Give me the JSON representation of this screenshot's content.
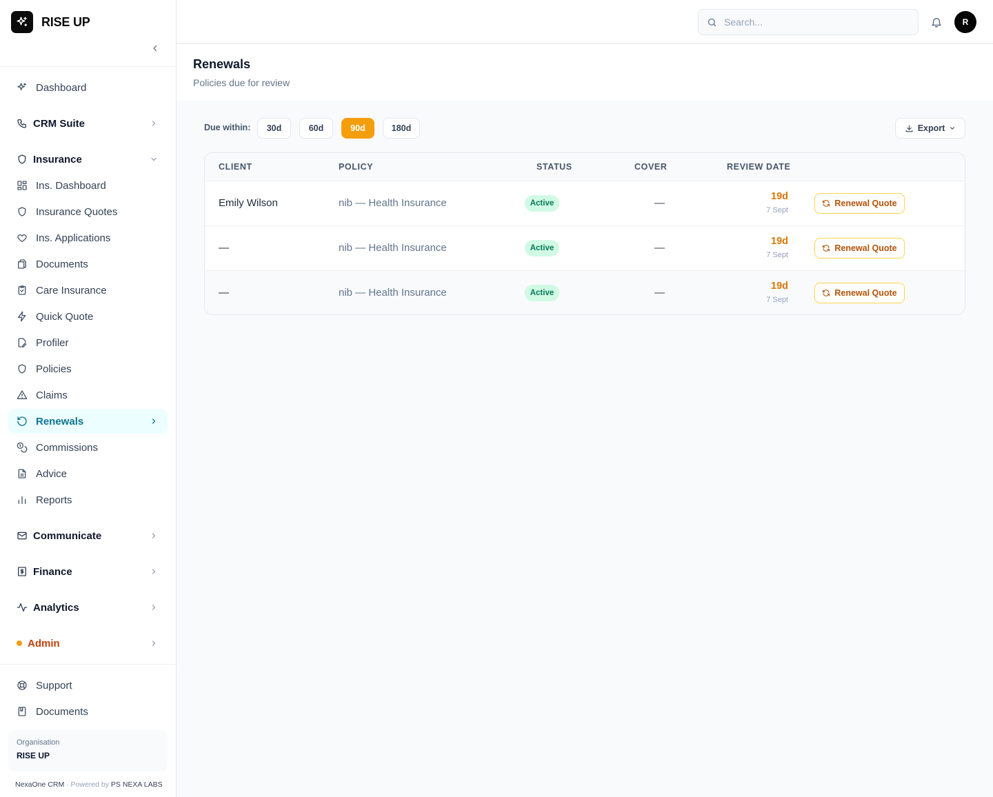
{
  "brand": {
    "name": "RISE UP"
  },
  "sidebar": {
    "items": [
      {
        "label": "Dashboard"
      },
      {
        "label": "CRM Suite"
      },
      {
        "label": "Insurance"
      },
      {
        "label": "Ins. Dashboard"
      },
      {
        "label": "Insurance Quotes"
      },
      {
        "label": "Ins. Applications"
      },
      {
        "label": "Documents"
      },
      {
        "label": "Care Insurance"
      },
      {
        "label": "Quick Quote"
      },
      {
        "label": "Profiler"
      },
      {
        "label": "Policies"
      },
      {
        "label": "Claims"
      },
      {
        "label": "Renewals"
      },
      {
        "label": "Commissions"
      },
      {
        "label": "Advice"
      },
      {
        "label": "Reports"
      },
      {
        "label": "Communicate"
      },
      {
        "label": "Finance"
      },
      {
        "label": "Analytics"
      },
      {
        "label": "Admin"
      }
    ],
    "footer_items": [
      {
        "label": "Support"
      },
      {
        "label": "Documents"
      }
    ],
    "org": {
      "label": "Organisation",
      "name": "RISE UP"
    },
    "powered": {
      "product": "NexaOne CRM",
      "separator": " · Powered by ",
      "company": "PS NEXA LABS"
    }
  },
  "topbar": {
    "search_placeholder": "Search...",
    "avatar_initial": "R"
  },
  "page": {
    "title": "Renewals",
    "subtitle": "Policies due for review"
  },
  "filters": {
    "label": "Due within:",
    "options": [
      "30d",
      "60d",
      "90d",
      "180d"
    ],
    "selected": "90d",
    "export_label": "Export"
  },
  "table": {
    "headers": [
      "CLIENT",
      "POLICY",
      "STATUS",
      "COVER",
      "REVIEW DATE"
    ],
    "rows": [
      {
        "client": "Emily Wilson",
        "policy": "nib — Health Insurance",
        "status": "Active",
        "cover": "—",
        "days": "19d",
        "date": "7 Sept",
        "action": "Renewal Quote"
      },
      {
        "client": "—",
        "policy": "nib — Health Insurance",
        "status": "Active",
        "cover": "—",
        "days": "19d",
        "date": "7 Sept",
        "action": "Renewal Quote"
      },
      {
        "client": "—",
        "policy": "nib — Health Insurance",
        "status": "Active",
        "cover": "—",
        "days": "19d",
        "date": "7 Sept",
        "action": "Renewal Quote"
      }
    ]
  },
  "colors": {
    "accent": "#f59e0b",
    "active_nav": "#0e7490",
    "status_active_bg": "#d1fae5",
    "status_active_text": "#047857",
    "admin": "#c2410c"
  },
  "icons": {
    "brand": "sparkles-icon",
    "collapse": "chevron-left-icon",
    "search": "search-icon",
    "notifications": "bell-icon",
    "export": "download-icon",
    "renewal": "refresh-icon"
  }
}
